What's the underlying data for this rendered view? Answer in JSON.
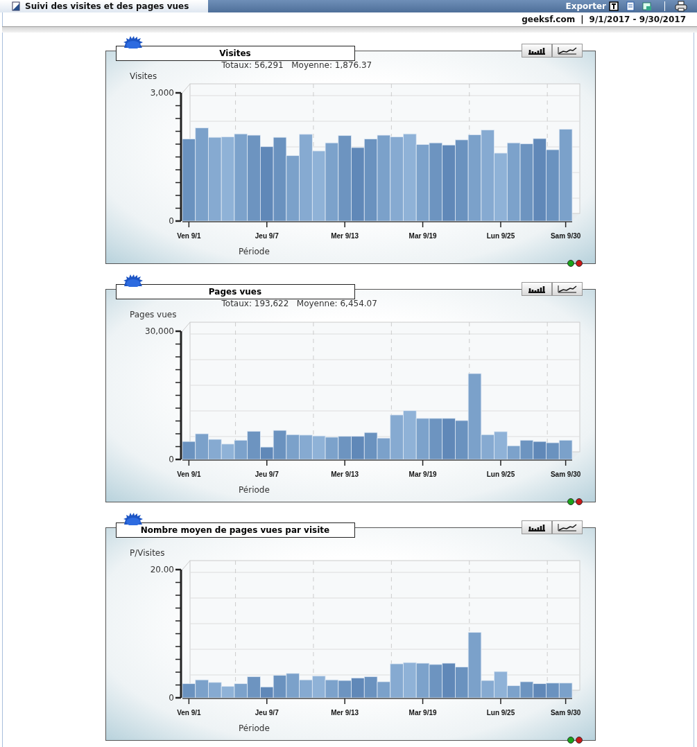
{
  "header": {
    "tab_title": "Suivi des visites et des pages vues",
    "export_label": "Exporter",
    "site": "geeksf.com",
    "separator": "|",
    "date_range": "9/1/2017 - 9/30/2017"
  },
  "charts": [
    {
      "title": "Visites",
      "summary": "Totaux: 56,291   Moyenne: 1,876.37",
      "chart_data": {
        "type": "bar",
        "xlabel": "Période",
        "ylabel": "Visites",
        "categories": [
          "Ven 9/1",
          null,
          null,
          null,
          null,
          null,
          "Jeu 9/7",
          null,
          null,
          null,
          null,
          null,
          "Mer 9/13",
          null,
          null,
          null,
          null,
          null,
          "Mar 9/19",
          null,
          null,
          null,
          null,
          null,
          "Lun 9/25",
          null,
          null,
          null,
          null,
          "Sam 9/30"
        ],
        "ylim": [
          0,
          3000
        ],
        "yticks": [
          {
            "value": 0,
            "label": "0"
          },
          {
            "value": 3000,
            "label": "3,000"
          }
        ],
        "values": [
          1920,
          2180,
          1960,
          1970,
          2040,
          2010,
          1740,
          1960,
          1530,
          2030,
          1640,
          1830,
          2000,
          1720,
          1920,
          2010,
          1970,
          2040,
          1790,
          1830,
          1780,
          1900,
          2020,
          2130,
          1590,
          1830,
          1810,
          1930,
          1670,
          2150
        ]
      }
    },
    {
      "title": "Pages vues",
      "summary": "Totaux: 193,622   Moyenne: 6,454.07",
      "chart_data": {
        "type": "bar",
        "xlabel": "Période",
        "ylabel": "Pages vues",
        "categories": [
          "Ven 9/1",
          null,
          null,
          null,
          null,
          null,
          "Jeu 9/7",
          null,
          null,
          null,
          null,
          null,
          "Mer 9/13",
          null,
          null,
          null,
          null,
          null,
          "Mar 9/19",
          null,
          null,
          null,
          null,
          null,
          "Lun 9/25",
          null,
          null,
          null,
          null,
          "Sam 9/30"
        ],
        "ylim": [
          0,
          30000
        ],
        "yticks": [
          {
            "value": 0,
            "label": "0"
          },
          {
            "value": 30000,
            "label": "30,000"
          }
        ],
        "values": [
          4200,
          6000,
          4700,
          3600,
          4500,
          6600,
          2900,
          6800,
          5800,
          5700,
          5500,
          5200,
          5400,
          5400,
          6300,
          5000,
          10400,
          11400,
          9600,
          9600,
          9600,
          9100,
          20100,
          5800,
          6500,
          3200,
          4500,
          4200,
          3900,
          4500
        ]
      }
    },
    {
      "title": "Nombre moyen de pages vues par visite",
      "chart_data": {
        "type": "bar",
        "xlabel": "Période",
        "ylabel": "P/Visites",
        "categories": [
          "Ven 9/1",
          null,
          null,
          null,
          null,
          null,
          "Jeu 9/7",
          null,
          null,
          null,
          null,
          null,
          "Mer 9/13",
          null,
          null,
          null,
          null,
          null,
          "Mar 9/19",
          null,
          null,
          null,
          null,
          null,
          "Lun 9/25",
          null,
          null,
          null,
          null,
          "Sam 9/30"
        ],
        "ylim": [
          0,
          20
        ],
        "yticks": [
          {
            "value": 0,
            "label": "0"
          },
          {
            "value": 20,
            "label": "20.00"
          }
        ],
        "values": [
          2.2,
          2.8,
          2.4,
          1.8,
          2.2,
          3.3,
          1.7,
          3.5,
          3.8,
          2.8,
          3.4,
          2.8,
          2.7,
          3.1,
          3.3,
          2.5,
          5.3,
          5.5,
          5.4,
          5.2,
          5.4,
          4.8,
          10.2,
          2.7,
          4.1,
          1.9,
          2.5,
          2.2,
          2.3,
          2.3
        ]
      }
    }
  ]
}
